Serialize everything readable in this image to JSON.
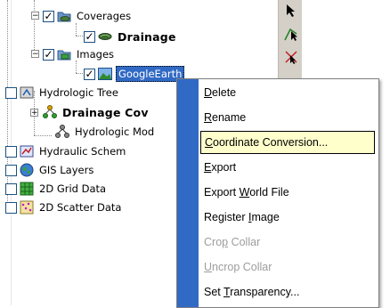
{
  "tree": {
    "items": [
      {
        "label": "Coverages",
        "checked": true,
        "icon": "coverages-folder-icon"
      },
      {
        "label": "Drainage",
        "checked": true,
        "icon": "drainage-coverage-icon"
      },
      {
        "label": "Images",
        "checked": true,
        "icon": "images-folder-icon"
      },
      {
        "label": "GoogleEarth",
        "checked": true,
        "icon": "image-icon",
        "selected": true
      },
      {
        "label": "Hydrologic Tree",
        "checked": false,
        "icon": "hydrologic-tree-icon"
      },
      {
        "label": "Drainage Cov",
        "checked": null,
        "icon": "drainage-coverage-tree-icon"
      },
      {
        "label": "Hydrologic Mod",
        "checked": null,
        "icon": "hydrologic-model-icon"
      },
      {
        "label": "Hydraulic Schem",
        "checked": false,
        "icon": "hydraulic-schematic-icon"
      },
      {
        "label": "GIS Layers",
        "checked": false,
        "icon": "globe-icon"
      },
      {
        "label": "2D Grid Data",
        "checked": false,
        "icon": "grid-icon"
      },
      {
        "label": "2D Scatter Data",
        "checked": false,
        "icon": "scatter-icon"
      }
    ]
  },
  "toolbar": {
    "tools": [
      "select-arrow-icon",
      "select-vertex-icon",
      "add-point-icon"
    ]
  },
  "context_menu": {
    "items": [
      {
        "pre": "",
        "mnemonic": "D",
        "post": "elete",
        "enabled": true
      },
      {
        "pre": "",
        "mnemonic": "R",
        "post": "ename",
        "enabled": true
      },
      {
        "pre": "",
        "mnemonic": "C",
        "post": "oordinate Conversion...",
        "enabled": true,
        "highlighted": true
      },
      {
        "pre": "",
        "mnemonic": "E",
        "post": "xport",
        "enabled": true
      },
      {
        "pre": "Export ",
        "mnemonic": "W",
        "post": "orld File",
        "enabled": true
      },
      {
        "pre": "Register ",
        "mnemonic": "I",
        "post": "mage",
        "enabled": true
      },
      {
        "pre": "Cro",
        "mnemonic": "p",
        "post": " Collar",
        "enabled": false
      },
      {
        "pre": "",
        "mnemonic": "U",
        "post": "ncrop Collar",
        "enabled": false
      },
      {
        "pre": "Set ",
        "mnemonic": "T",
        "post": "ransparency...",
        "enabled": true
      }
    ]
  },
  "colors": {
    "selection": "#316ac5",
    "menu_gutter": "#316ac5",
    "menu_highlight": "#ffffcc",
    "toolbar": "#d4d0c8"
  }
}
